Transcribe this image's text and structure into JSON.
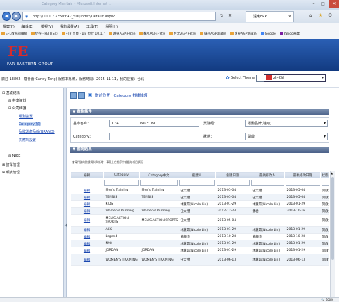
{
  "browser": {
    "window_title_faded": "Category Maintain - Microsoft Internet ...",
    "url": "http://10.1.7.235/FEA2_SDI/Index/Default.aspx?T...",
    "tab_title": "遠東ERP",
    "menu": [
      "檔案(F)",
      "編輯(E)",
      "檢視(V)",
      "我的最愛(A)",
      "工具(T)",
      "說明(H)"
    ],
    "favorites": [
      "EFL教育訓練網",
      "登券 - FEIT(SZ)",
      "FTP 首頁 - plc 位於 10.1.7",
      "遠東AGP正式區",
      "蘇州AGP正式區",
      "台北AGP正式區",
      "蘇州AGP測試區",
      "遠東AGP測試區",
      "Google",
      "Yahoo奇摩"
    ]
  },
  "header": {
    "logo_text": "FE",
    "company_name": "FAR EASTERN GROUP"
  },
  "infobar": {
    "text": "歡迎 13802 - 唐蕾蕾(Candy Tang) 服務本系統，服務時間：2015-11-11，我的位置：台北",
    "theme_label": "Select Theme",
    "theme_value": "",
    "language_value": "zh-CN"
  },
  "leftnav": {
    "items": [
      {
        "label": "基礎結構",
        "level": 0
      },
      {
        "label": "共享資料",
        "level": 1
      },
      {
        "label": "公司維護",
        "level": 1
      },
      {
        "label": "類別設置",
        "level": 2
      },
      {
        "label": "Category(類)",
        "level": 2
      },
      {
        "label": "品牌與產品線(BRAND)",
        "level": 2
      },
      {
        "label": "供應商設置",
        "level": 2
      },
      {
        "label": "NIKE",
        "level": 1
      },
      {
        "label": "訂單管理",
        "level": 0
      },
      {
        "label": "報表管理",
        "level": 0
      }
    ]
  },
  "page": {
    "position": "當前位置：Category 數據維護",
    "query_title": "查詢條件",
    "results_title": "查詢結果",
    "note": "會員代號的數據資料與新增，事實上在前序中維護的項目狀況"
  },
  "query": {
    "customer_label": "基本客戶：",
    "customer_code": "C34",
    "customer_name": "NIKE, INC.",
    "business_label": "業務組：",
    "business_value": "運動品牌(鞋用)",
    "category_label": "Category：",
    "category_value": "",
    "status_label": "狀態：",
    "status_value": "開啟"
  },
  "grid": {
    "columns": [
      "編輯",
      "Category",
      "Category中文",
      "創建人",
      "創建日期",
      "最後修改人",
      "最後修改日期",
      "狀態"
    ],
    "rows": [
      {
        "edit": "編輯",
        "cat": "Men's Training",
        "cat_cn": "Men's Training",
        "creator": "任大禮",
        "created": "2013-05-04",
        "modifier": "任大禮",
        "modified": "2013-05-04",
        "status": "開啟"
      },
      {
        "edit": "編輯",
        "cat": "TENNIS",
        "cat_cn": "TENNIS",
        "creator": "任大禮",
        "created": "2013-05-04",
        "modifier": "任大禮",
        "modified": "2013-05-04",
        "status": "開啟"
      },
      {
        "edit": "編輯",
        "cat": "KIDS",
        "cat_cn": "",
        "creator": "林蕙茹(Nicole Lin)",
        "created": "2013-01-29",
        "modifier": "林蕙茹(Nicole Lin)",
        "modified": "2013-01-29",
        "status": "開啟"
      },
      {
        "edit": "編輯",
        "cat": "Women's Running",
        "cat_cn": "Women's Running",
        "creator": "任大禮",
        "created": "2012-12-24",
        "modifier": "潘君",
        "modified": "2013-10-16",
        "status": "開啟"
      },
      {
        "edit": "編輯",
        "cat": "MEN'S ACTION SPORTS",
        "cat_cn": "MEN'S ACTION SPORTS",
        "creator": "任大禮",
        "created": "2013-05-04",
        "modifier": "",
        "modified": "",
        "status": "開啟"
      },
      {
        "edit": "編輯",
        "cat": "ACG",
        "cat_cn": "",
        "creator": "林蕙茹(Nicole Lin)",
        "created": "2013-01-29",
        "modifier": "林蕙茹(Nicole Lin)",
        "modified": "2013-01-29",
        "status": "開啟"
      },
      {
        "edit": "編輯",
        "cat": "Legend",
        "cat_cn": "",
        "creator": "黃靜玲",
        "created": "2013-10-28",
        "modifier": "黃靜玲",
        "modified": "2013-10-28",
        "status": "開啟"
      },
      {
        "edit": "編輯",
        "cat": "N98",
        "cat_cn": "",
        "creator": "林蕙茹(Nicole Lin)",
        "created": "2013-01-29",
        "modifier": "林蕙茹(Nicole Lin)",
        "modified": "2013-01-29",
        "status": "開啟"
      },
      {
        "edit": "編輯",
        "cat": "JORDAN",
        "cat_cn": "JORDAN",
        "creator": "林蕙茹(Nicole Lin)",
        "created": "2013-01-29",
        "modifier": "林蕙茹(Nicole Lin)",
        "modified": "2013-01-29",
        "status": "開啟"
      },
      {
        "edit": "編輯",
        "cat": "WOMEN'S TRAINING",
        "cat_cn": "WOMEN'S TRAINING",
        "creator": "任大禮",
        "created": "2013-06-13",
        "modifier": "林蕙茹(Nicole Lin)",
        "modified": "2013-06-13",
        "status": "開啟"
      }
    ]
  },
  "status": {
    "zoom": "100%"
  },
  "colors": {
    "header_blue": "#1f4c9c",
    "link_blue": "#1a47b0",
    "logo_red": "#d82a2a"
  }
}
